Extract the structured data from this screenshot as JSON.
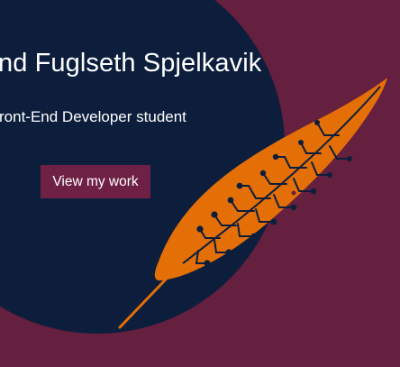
{
  "hero": {
    "name": "nd Fuglseth Spjelkavik",
    "role": "ront-End Developer student",
    "cta_label": "View my work"
  },
  "colors": {
    "background": "#651f3f",
    "circle": "#0d1e3d",
    "leaf": "#e36f06",
    "button": "#6e2145",
    "text": "#ffffff"
  },
  "icons": {
    "leaf": "circuit-leaf-icon"
  }
}
